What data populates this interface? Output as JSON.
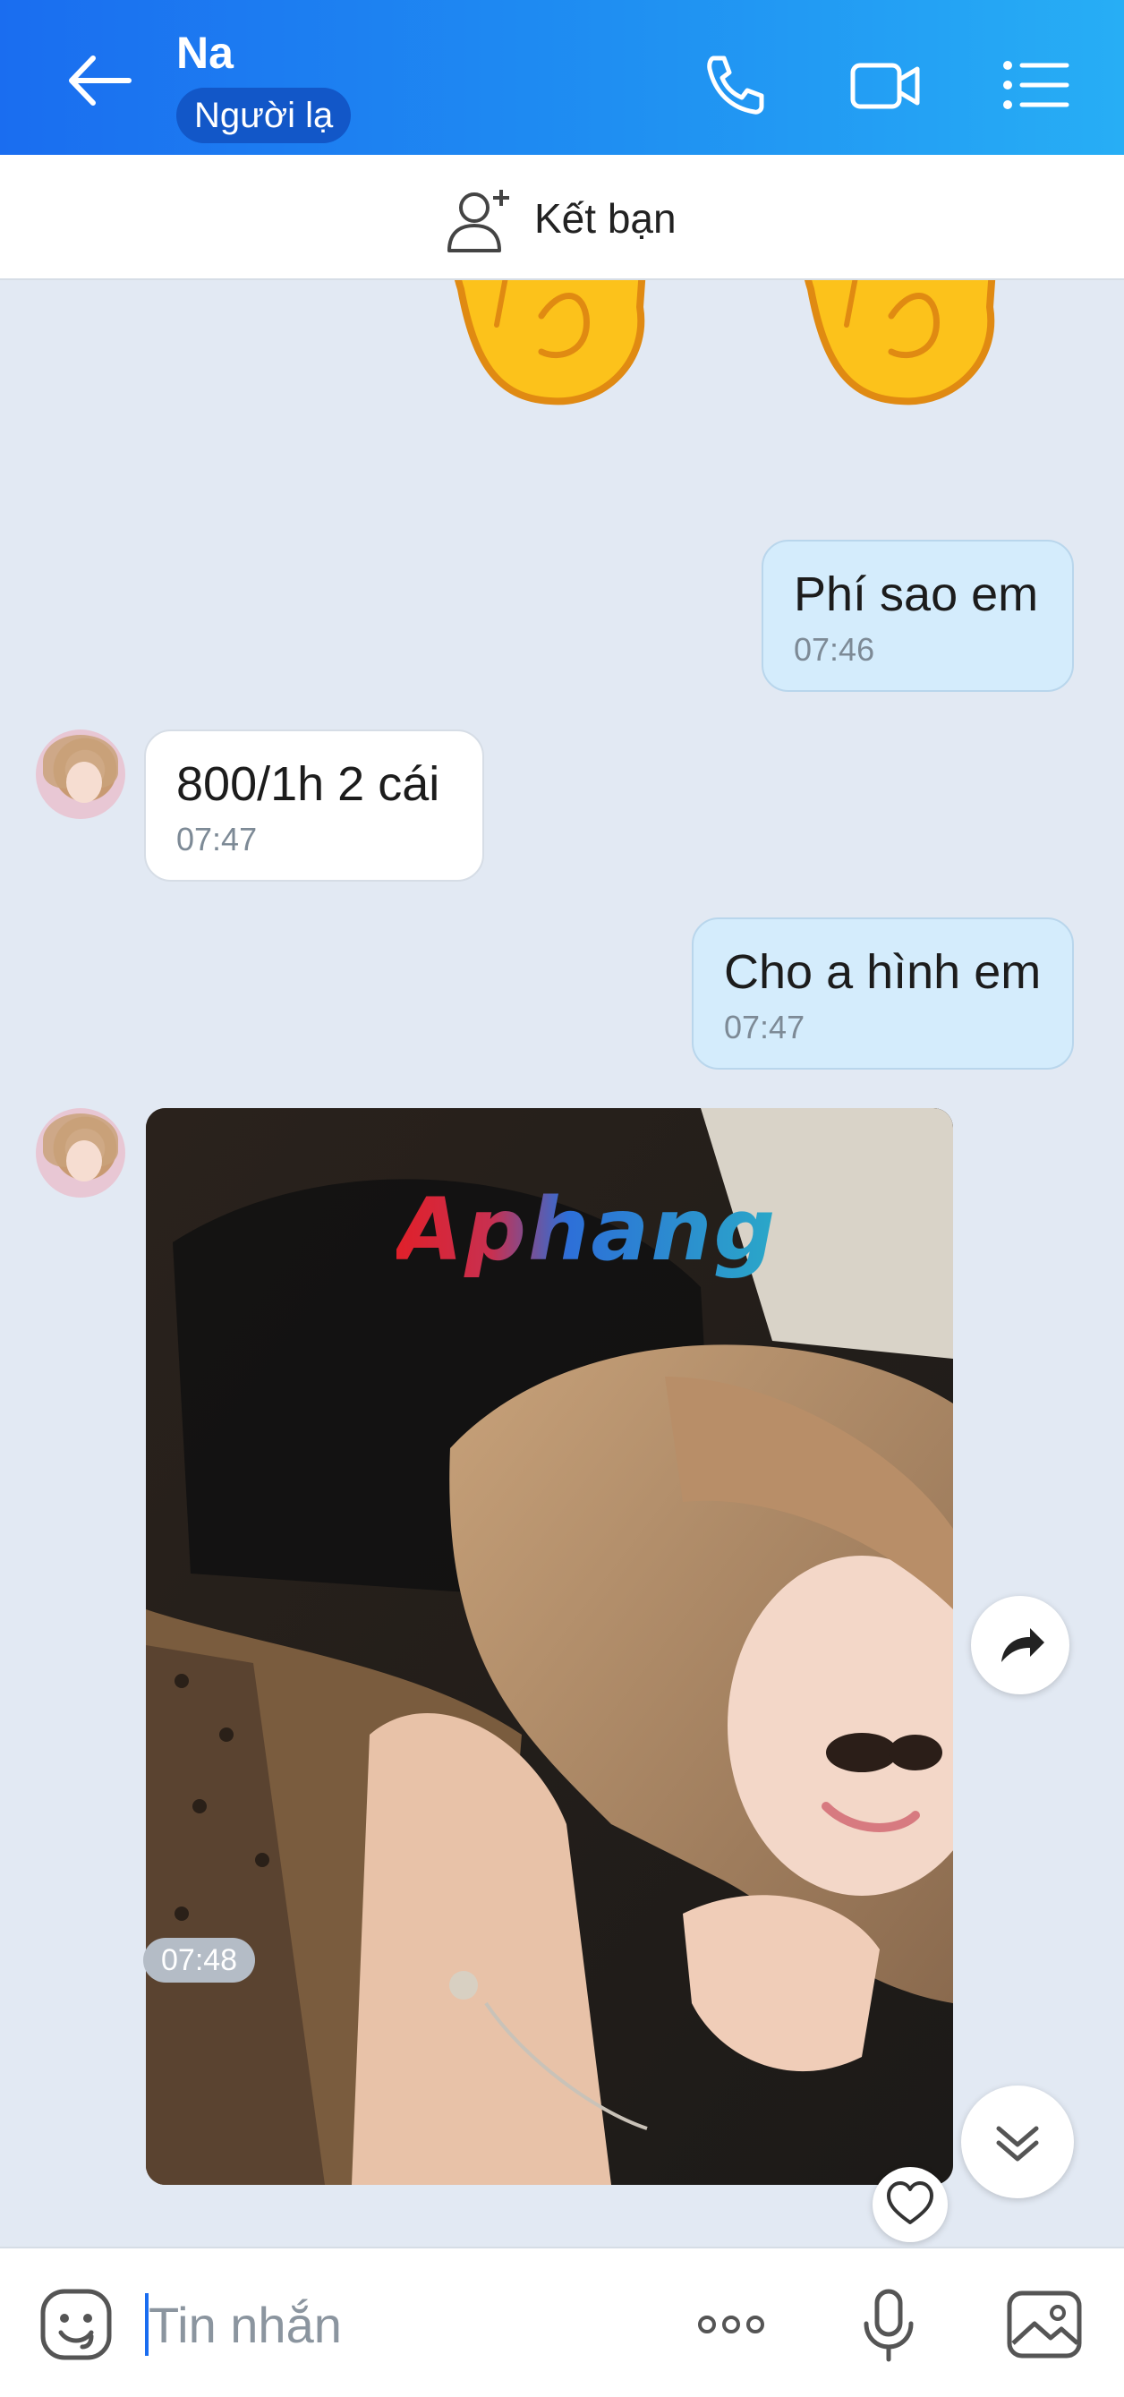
{
  "header": {
    "contact_name": "Na",
    "contact_status": "Người lạ",
    "icons": [
      "back-arrow-icon",
      "phone-icon",
      "video-call-icon",
      "menu-list-icon"
    ]
  },
  "friend_bar": {
    "label": "Kết bạn",
    "icon": "add-friend-icon"
  },
  "messages": [
    {
      "sender": "other",
      "type": "sticker",
      "content": "waving-hand-emoji"
    },
    {
      "sender": "me",
      "type": "text",
      "text": "Phí sao em",
      "time": "07:46"
    },
    {
      "sender": "other",
      "type": "text",
      "text": "800/1h 2 cái",
      "time": "07:47"
    },
    {
      "sender": "me",
      "type": "text",
      "text": "Cho a hình em",
      "time": "07:47"
    },
    {
      "sender": "other",
      "type": "image",
      "watermark": "Aphang",
      "time": "07:48"
    }
  ],
  "input": {
    "placeholder": "Tin nhắn",
    "icons": [
      "sticker-icon",
      "more-icon",
      "microphone-icon",
      "gallery-icon"
    ]
  },
  "colors": {
    "header_start": "#1a6df0",
    "header_end": "#27aef5",
    "chat_background": "#e2e9f3",
    "my_bubble": "#d4ecfc",
    "their_bubble": "#ffffff"
  }
}
